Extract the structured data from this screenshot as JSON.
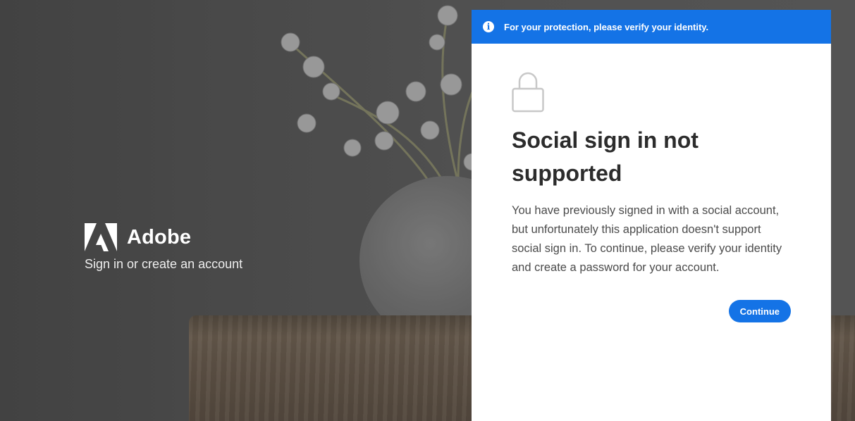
{
  "brand": {
    "name": "Adobe",
    "tagline": "Sign in or create an account"
  },
  "banner": {
    "icon": "info-icon",
    "message": "For your protection, please verify your identity."
  },
  "dialog": {
    "icon": "lock-icon",
    "title": "Social sign in not supported",
    "description": "You have previously signed in with a social account, but unfortunately this application doesn't support social sign in. To continue, please verify your identity and create a password for your account.",
    "continue_label": "Continue"
  },
  "colors": {
    "accent": "#1473e6",
    "title_text": "#2c2c2c",
    "body_text": "#4b4b4b"
  }
}
